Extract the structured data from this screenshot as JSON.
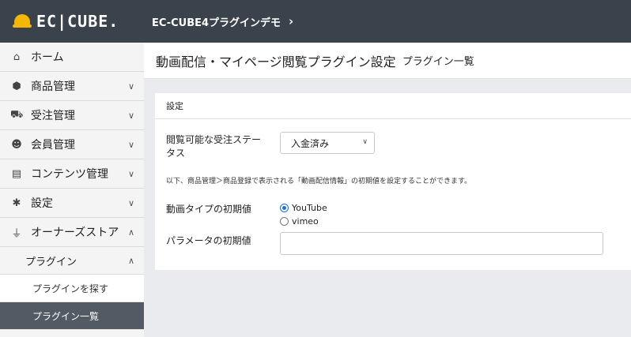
{
  "header": {
    "logo_text": "EC|CUBE.",
    "shop_name": "EC-CUBE4プラグインデモ",
    "shop_arrow": "›"
  },
  "sidebar": {
    "items": [
      {
        "label": "ホーム",
        "icon": "home-icon",
        "glyph": "⌂",
        "chevron": ""
      },
      {
        "label": "商品管理",
        "icon": "cube-icon",
        "glyph": "⬢",
        "chevron": "∨"
      },
      {
        "label": "受注管理",
        "icon": "cart-icon",
        "glyph": "⛟",
        "chevron": "∨"
      },
      {
        "label": "会員管理",
        "icon": "users-icon",
        "glyph": "☻",
        "chevron": "∨"
      },
      {
        "label": "コンテンツ管理",
        "icon": "file-icon",
        "glyph": "▤",
        "chevron": "∨"
      },
      {
        "label": "設定",
        "icon": "gear-icon",
        "glyph": "✱",
        "chevron": "∨"
      },
      {
        "label": "オーナーズストア",
        "icon": "plug-icon",
        "glyph": "⏚",
        "chevron": "∧"
      }
    ],
    "sub_item": {
      "label": "プラグイン",
      "chevron": "∧"
    },
    "subsub_items": [
      {
        "label": "プラグインを探す"
      },
      {
        "label": "プラグイン一覧"
      }
    ]
  },
  "main": {
    "title": "動画配信・マイページ閲覧プラグイン設定",
    "subtitle": "プラグイン一覧",
    "card": {
      "header": "設定",
      "status_label_line1": "閲覧可能な受注ステー",
      "status_label_line2": "タス",
      "status_select_value": "入金済み",
      "note": "以下、商品管理＞商品登録で表示される「動画配信情報」の初期値を設定することができます。",
      "video_type_label": "動画タイプの初期値",
      "radio_options": [
        {
          "label": "YouTube",
          "checked": true
        },
        {
          "label": "vimeo",
          "checked": false
        }
      ],
      "param_label": "パラメータの初期値",
      "param_value": ""
    }
  },
  "colors": {
    "header_bg": "#3a424c",
    "accent_yellow": "#f5b800",
    "active_nav_bg": "#525a63",
    "radio_blue": "#1e6fd9"
  }
}
